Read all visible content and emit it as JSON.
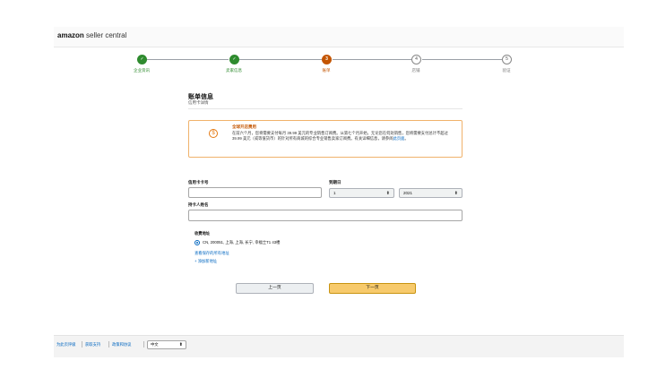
{
  "header": {
    "brand": "amazon",
    "product": " seller central"
  },
  "stepper": {
    "steps": [
      {
        "number": "✓",
        "label": "企业资讯",
        "state": "done"
      },
      {
        "number": "✓",
        "label": "卖家信息",
        "state": "done"
      },
      {
        "number": "3",
        "label": "账单",
        "state": "current"
      },
      {
        "number": "4",
        "label": "店铺",
        "state": "todo"
      },
      {
        "number": "5",
        "label": "验证",
        "state": "todo"
      }
    ]
  },
  "section": {
    "title": "账单信息",
    "subtitle": "信用卡详情"
  },
  "notice": {
    "icon": "dollar-icon",
    "title": "全球开店费用",
    "body": "在前六个月，您将需要支付每月 39.99 美元的专业销售订阅费。从第七个月开始，无论您在何处销售，您将需要支付总计不超过 39.99 美元（或等值货币）的针对所有商城的综合专业销售卖家订阅费。有关详细信息，请参阅",
    "link": "此页面",
    "end": "。"
  },
  "form": {
    "card_number_label": "信用卡卡号",
    "card_number_value": "",
    "expiry_label": "到期日",
    "expiry_month": "1",
    "expiry_year": "2021",
    "cardholder_label": "持卡人姓名",
    "cardholder_value": ""
  },
  "address": {
    "label": "收费地址",
    "selected": "CN, 200051, 上海, 上海, 长宁, 幸福士T1 43楼",
    "view_saved": "查看保存的所有地址",
    "add_new": "+ 添加新地址"
  },
  "buttons": {
    "prev": "上一页",
    "next": "下一页"
  },
  "footer": {
    "links": [
      "为此页评级",
      "获取支持",
      "政策和协议"
    ],
    "language": "中文"
  },
  "colors": {
    "done": "#2e8b2e",
    "current": "#c45500",
    "accent_button": "#f7ca6c",
    "link": "#0066c0"
  }
}
